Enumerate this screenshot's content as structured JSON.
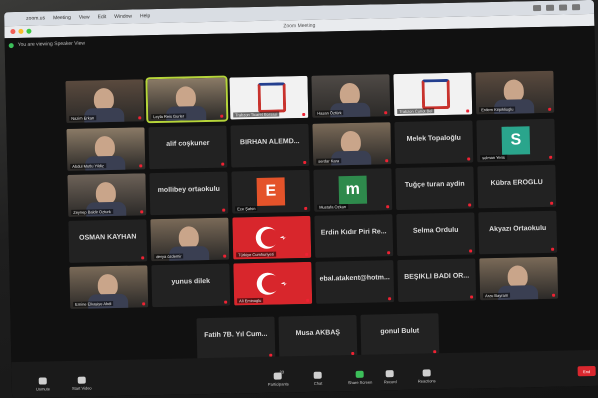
{
  "window_title": "Zoom Meeting",
  "speaker_view_label": "You are viewing Speaker View",
  "participants": [
    {
      "name": "",
      "caption": "Nazim Erkan",
      "type": "video"
    },
    {
      "name": "",
      "caption": "Leyla Reis Gurler",
      "type": "video",
      "active": true
    },
    {
      "name": "",
      "caption": "Trabzon Ticaret Borsasi",
      "type": "logo"
    },
    {
      "name": "",
      "caption": "Hasan Öztürk",
      "type": "video"
    },
    {
      "name": "",
      "caption": "Trabzon Cunot Bel",
      "type": "logo"
    },
    {
      "name": "",
      "caption": "Erdem Kirpiklioglu",
      "type": "video"
    },
    {
      "name": "",
      "caption": "Abdul Mutlu Yildiz",
      "type": "video"
    },
    {
      "name": "alif coşkuner",
      "caption": "",
      "type": "text"
    },
    {
      "name": "BİRHAN ALEMD...",
      "caption": "",
      "type": "text"
    },
    {
      "name": "",
      "caption": "serdar Kara",
      "type": "video"
    },
    {
      "name": "Melek Topaloğlu",
      "caption": "",
      "type": "text"
    },
    {
      "name": "",
      "caption": "selman Yeris",
      "type": "letter",
      "letter": "S",
      "color": "#2aa58c"
    },
    {
      "name": "",
      "caption": "Zeynep Baldir Ozturk",
      "type": "video"
    },
    {
      "name": "mollibey ortaokulu",
      "caption": "",
      "type": "text"
    },
    {
      "name": "",
      "caption": "Ece Şahin",
      "type": "letter",
      "letter": "E",
      "color": "#e4532a"
    },
    {
      "name": "",
      "caption": "Mustafa Ozkan",
      "type": "letter",
      "letter": "m",
      "color": "#2e8a4c"
    },
    {
      "name": "Tuğçe turan aydin",
      "caption": "",
      "type": "text"
    },
    {
      "name": "Kübra EROĞLU",
      "caption": "",
      "type": "text"
    },
    {
      "name": "OSMAN KAYHAN",
      "caption": "",
      "type": "text"
    },
    {
      "name": "",
      "caption": "derya özdemir",
      "type": "video"
    },
    {
      "name": "",
      "caption": "Türkiye Cumhuriyeti",
      "type": "flag"
    },
    {
      "name": "Erdin Kıdır Piri Re...",
      "caption": "",
      "type": "text"
    },
    {
      "name": "Selma Ordulu",
      "caption": "",
      "type": "text"
    },
    {
      "name": "Akyazı Ortaokulu",
      "caption": "",
      "type": "text"
    },
    {
      "name": "",
      "caption": "Emine Elkasiye Abdi",
      "type": "video"
    },
    {
      "name": "yunus dilek",
      "caption": "",
      "type": "text"
    },
    {
      "name": "",
      "caption": "Ali Eminoglu",
      "type": "flag"
    },
    {
      "name": "ebal.atakent@hotm...",
      "caption": "",
      "type": "text"
    },
    {
      "name": "BEŞİKLİ BADİ OR...",
      "caption": "",
      "type": "text"
    },
    {
      "name": "",
      "caption": "Arzu Bayram",
      "type": "video"
    },
    {
      "name": "Fatih 7B. Yıl Cum...",
      "caption": "",
      "type": "text"
    },
    {
      "name": "Musa AKBAŞ",
      "caption": "",
      "type": "text"
    },
    {
      "name": "gonul Bulut",
      "caption": "",
      "type": "text"
    }
  ],
  "controls": {
    "unmute": "Unmute",
    "video": "Start Video",
    "participants": "Participants",
    "participants_count": "33",
    "chat": "Chat",
    "share": "Share Screen",
    "record": "Record",
    "reactions": "Reactions",
    "end": "End"
  },
  "colors": {
    "active_border": "#b6d53a",
    "share_green": "#3cbf5a",
    "end_red": "#d9272e"
  }
}
